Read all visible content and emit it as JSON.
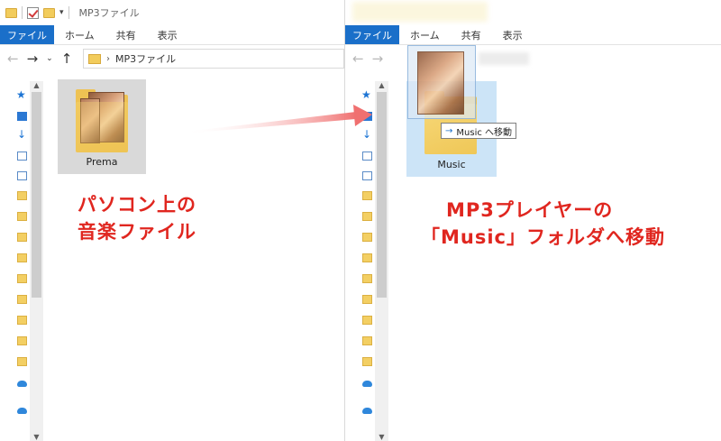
{
  "left_window": {
    "title": "MP3ファイル",
    "tabs": [
      "ファイル",
      "ホーム",
      "共有",
      "表示"
    ],
    "path": "MP3ファイル",
    "file": {
      "name": "Prema",
      "icon": "music-folder-icon"
    }
  },
  "right_window": {
    "tabs": [
      "ファイル",
      "ホーム",
      "共有",
      "表示"
    ],
    "folder": {
      "name": "Music",
      "icon": "folder-icon"
    },
    "drag_tooltip": "Music へ移動"
  },
  "captions": {
    "left": [
      "パソコン上の",
      "音楽ファイル"
    ],
    "right": [
      "MP3プレイヤーの",
      "「Music」フォルダへ移動"
    ]
  },
  "colors": {
    "caption": "#e0261f",
    "arrow": "#f07070",
    "ribbon_file_tab": "#1a6fc9",
    "selection": "#cce4f7"
  },
  "icons": {
    "back": "←",
    "forward": "→",
    "recent": "⌄",
    "up": "↑",
    "path_sep": "›",
    "tooltip_arrow": "→",
    "star": "★",
    "download": "↓",
    "scroll_up": "▲",
    "scroll_down": "▼"
  }
}
